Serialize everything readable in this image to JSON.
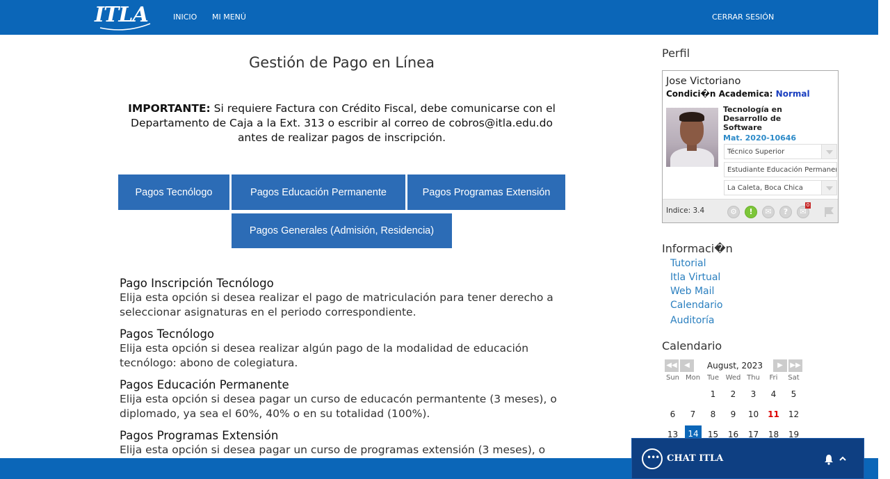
{
  "nav": {
    "logo_text": "ITLA",
    "inicio": "INICIO",
    "mi_menu": "MI MENÚ",
    "logout": "CERRAR SESIÓN"
  },
  "main": {
    "title": "Gestión de Pago en Línea",
    "notice_bold": "IMPORTANTE:",
    "notice_text": " Si requiere Factura con Crédito Fiscal, debe comunicarse con el Departamento de Caja a la Ext. 313 o escribir al correo de cobros@itla.edu.do antes de realizar pagos de inscripción.",
    "buttons": [
      "Pagos Tecnólogo",
      "Pagos Educación Permanente",
      "Pagos Programas Extensión",
      "Pagos Generales (Admisión, Residencia)"
    ],
    "sections": [
      {
        "title": "Pago Inscripción Tecnólogo",
        "text": "Elija esta opción si desea realizar el pago de matriculación para tener derecho a seleccionar asignaturas en el periodo correspondiente."
      },
      {
        "title": "Pagos Tecnólogo",
        "text": "Elija esta opción si desea realizar algún pago de la modalidad de educación tecnólogo: abono de colegiatura."
      },
      {
        "title": "Pagos Educación Permanente",
        "text": "Elija esta opción si desea pagar un curso de educacón permantente (3 meses), o diplomado, ya sea el 60%, 40% o en su totalidad (100%)."
      },
      {
        "title": "Pagos Programas Extensión",
        "text": "Elija esta opción si desea pagar un curso de programas extensión (3 meses), o"
      }
    ]
  },
  "sidebar": {
    "perfil_heading": "Perfil",
    "profile": {
      "name": "Jose Victoriano",
      "condition_label": "Condici�n Academica:",
      "condition_value": "Normal",
      "career": "Tecnología en Desarrollo de Software",
      "matricula": "Mat. 2020-10646",
      "select1": "Técnico Superior",
      "select2": "Estudiante Educación Permanente",
      "select3": "La Caleta, Boca Chica",
      "index": "Indice: 3.4",
      "notif_count": "0"
    },
    "info_heading": "Informaci�n",
    "info_links": [
      "Tutorial",
      "Itla Virtual",
      "Web Mail",
      "Calendario",
      "Auditoría"
    ],
    "calendar_heading": "Calendario",
    "calendar": {
      "month": "August, 2023",
      "prev_year": "◀◀",
      "prev": "◀",
      "next": "▶",
      "next_year": "▶▶",
      "days_of_week": [
        "Sun",
        "Mon",
        "Tue",
        "Wed",
        "Thu",
        "Fri",
        "Sat"
      ],
      "week1": [
        "1",
        "2",
        "3",
        "4",
        "5"
      ],
      "week2": [
        "6",
        "7",
        "8",
        "9",
        "10",
        "11",
        "12"
      ],
      "week3": [
        "13",
        "14",
        "15",
        "16",
        "17",
        "18",
        "19"
      ]
    }
  },
  "chat": {
    "label": "CHAT ITLA"
  },
  "colors": {
    "brand_blue": "#0b66b8",
    "button_blue": "#2c6cb6",
    "chat_navy": "#0e3f82",
    "link_blue": "#2a7fbf"
  }
}
